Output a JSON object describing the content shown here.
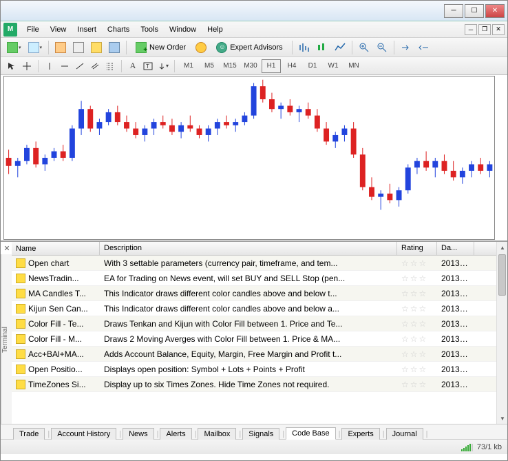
{
  "menu": {
    "items": [
      "File",
      "View",
      "Insert",
      "Charts",
      "Tools",
      "Window",
      "Help"
    ]
  },
  "toolbar": {
    "new_order": "New Order",
    "expert_advisors": "Expert Advisors"
  },
  "timeframes": [
    "M1",
    "M5",
    "M15",
    "M30",
    "H1",
    "H4",
    "D1",
    "W1",
    "MN"
  ],
  "active_timeframe": "H1",
  "terminal": {
    "label": "Terminal",
    "headers": {
      "name": "Name",
      "description": "Description",
      "rating": "Rating",
      "date": "Da..."
    },
    "rows": [
      {
        "name": "Open chart",
        "desc": "With 3 settable parameters (currency pair, timeframe, and tem...",
        "date": "2013.1..."
      },
      {
        "name": "NewsTradin...",
        "desc": "EA for Trading on News event, will set BUY and SELL Stop (pen...",
        "date": "2013.0..."
      },
      {
        "name": "MA Candles T...",
        "desc": "This Indicator draws different color candles above and below t...",
        "date": "2013.0..."
      },
      {
        "name": "Kijun Sen Can...",
        "desc": "This Indicator draws different color candles above and below a...",
        "date": "2013.0..."
      },
      {
        "name": "Color Fill - Te...",
        "desc": "Draws Tenkan and Kijun with Color Fill between 1. Price and Te...",
        "date": "2013.0..."
      },
      {
        "name": "Color Fill - M...",
        "desc": "Draws 2 Moving Averges with Color Fill between 1. Price & MA...",
        "date": "2013.0..."
      },
      {
        "name": "Acc+BAl+MA...",
        "desc": "Adds Account Balance, Equity, Margin, Free Margin and Profit t...",
        "date": "2013.0..."
      },
      {
        "name": "Open Positio...",
        "desc": "Displays open position: Symbol + Lots + Points + Profit",
        "date": "2013.0..."
      },
      {
        "name": "TimeZones Si...",
        "desc": "Display up to six Times Zones. Hide Time Zones not required.",
        "date": "2013.0..."
      }
    ],
    "tabs": [
      "Trade",
      "Account History",
      "News",
      "Alerts",
      "Mailbox",
      "Signals",
      "Code Base",
      "Experts",
      "Journal"
    ],
    "active_tab": "Code Base"
  },
  "status": {
    "transfer": "73/1 kb"
  },
  "chart_data": {
    "type": "candlestick",
    "note": "approximate OHLC read from pixels (relative scale 0-100)",
    "candles": [
      {
        "o": 50,
        "h": 55,
        "l": 40,
        "c": 45,
        "color": "red"
      },
      {
        "o": 45,
        "h": 50,
        "l": 38,
        "c": 48,
        "color": "blue"
      },
      {
        "o": 48,
        "h": 58,
        "l": 46,
        "c": 56,
        "color": "blue"
      },
      {
        "o": 56,
        "h": 60,
        "l": 44,
        "c": 46,
        "color": "red"
      },
      {
        "o": 46,
        "h": 52,
        "l": 42,
        "c": 50,
        "color": "blue"
      },
      {
        "o": 50,
        "h": 56,
        "l": 48,
        "c": 54,
        "color": "blue"
      },
      {
        "o": 54,
        "h": 58,
        "l": 48,
        "c": 50,
        "color": "red"
      },
      {
        "o": 50,
        "h": 70,
        "l": 48,
        "c": 68,
        "color": "blue"
      },
      {
        "o": 68,
        "h": 85,
        "l": 64,
        "c": 80,
        "color": "blue"
      },
      {
        "o": 80,
        "h": 82,
        "l": 66,
        "c": 68,
        "color": "red"
      },
      {
        "o": 68,
        "h": 74,
        "l": 64,
        "c": 72,
        "color": "blue"
      },
      {
        "o": 72,
        "h": 80,
        "l": 70,
        "c": 78,
        "color": "blue"
      },
      {
        "o": 78,
        "h": 82,
        "l": 70,
        "c": 72,
        "color": "red"
      },
      {
        "o": 72,
        "h": 76,
        "l": 66,
        "c": 68,
        "color": "red"
      },
      {
        "o": 68,
        "h": 72,
        "l": 62,
        "c": 64,
        "color": "red"
      },
      {
        "o": 64,
        "h": 70,
        "l": 60,
        "c": 68,
        "color": "blue"
      },
      {
        "o": 68,
        "h": 74,
        "l": 64,
        "c": 72,
        "color": "blue"
      },
      {
        "o": 72,
        "h": 76,
        "l": 68,
        "c": 70,
        "color": "red"
      },
      {
        "o": 70,
        "h": 74,
        "l": 64,
        "c": 66,
        "color": "red"
      },
      {
        "o": 66,
        "h": 72,
        "l": 62,
        "c": 70,
        "color": "blue"
      },
      {
        "o": 70,
        "h": 76,
        "l": 66,
        "c": 68,
        "color": "red"
      },
      {
        "o": 68,
        "h": 70,
        "l": 62,
        "c": 64,
        "color": "red"
      },
      {
        "o": 64,
        "h": 70,
        "l": 60,
        "c": 68,
        "color": "blue"
      },
      {
        "o": 68,
        "h": 74,
        "l": 64,
        "c": 72,
        "color": "blue"
      },
      {
        "o": 72,
        "h": 76,
        "l": 68,
        "c": 70,
        "color": "red"
      },
      {
        "o": 70,
        "h": 74,
        "l": 66,
        "c": 72,
        "color": "blue"
      },
      {
        "o": 72,
        "h": 78,
        "l": 70,
        "c": 76,
        "color": "blue"
      },
      {
        "o": 76,
        "h": 96,
        "l": 74,
        "c": 94,
        "color": "blue"
      },
      {
        "o": 94,
        "h": 98,
        "l": 84,
        "c": 86,
        "color": "red"
      },
      {
        "o": 86,
        "h": 90,
        "l": 78,
        "c": 80,
        "color": "red"
      },
      {
        "o": 80,
        "h": 84,
        "l": 74,
        "c": 82,
        "color": "blue"
      },
      {
        "o": 82,
        "h": 86,
        "l": 76,
        "c": 78,
        "color": "red"
      },
      {
        "o": 78,
        "h": 82,
        "l": 72,
        "c": 80,
        "color": "blue"
      },
      {
        "o": 80,
        "h": 84,
        "l": 74,
        "c": 76,
        "color": "red"
      },
      {
        "o": 76,
        "h": 80,
        "l": 66,
        "c": 68,
        "color": "red"
      },
      {
        "o": 68,
        "h": 72,
        "l": 58,
        "c": 60,
        "color": "red"
      },
      {
        "o": 60,
        "h": 66,
        "l": 56,
        "c": 64,
        "color": "blue"
      },
      {
        "o": 64,
        "h": 70,
        "l": 60,
        "c": 68,
        "color": "blue"
      },
      {
        "o": 68,
        "h": 72,
        "l": 50,
        "c": 52,
        "color": "red"
      },
      {
        "o": 52,
        "h": 56,
        "l": 30,
        "c": 32,
        "color": "red"
      },
      {
        "o": 32,
        "h": 38,
        "l": 24,
        "c": 26,
        "color": "red"
      },
      {
        "o": 26,
        "h": 30,
        "l": 18,
        "c": 28,
        "color": "blue"
      },
      {
        "o": 28,
        "h": 34,
        "l": 22,
        "c": 24,
        "color": "red"
      },
      {
        "o": 24,
        "h": 32,
        "l": 20,
        "c": 30,
        "color": "blue"
      },
      {
        "o": 30,
        "h": 46,
        "l": 28,
        "c": 44,
        "color": "blue"
      },
      {
        "o": 44,
        "h": 50,
        "l": 40,
        "c": 48,
        "color": "blue"
      },
      {
        "o": 48,
        "h": 54,
        "l": 42,
        "c": 44,
        "color": "red"
      },
      {
        "o": 44,
        "h": 50,
        "l": 38,
        "c": 48,
        "color": "blue"
      },
      {
        "o": 48,
        "h": 52,
        "l": 40,
        "c": 42,
        "color": "red"
      },
      {
        "o": 42,
        "h": 48,
        "l": 36,
        "c": 38,
        "color": "red"
      },
      {
        "o": 38,
        "h": 44,
        "l": 34,
        "c": 42,
        "color": "blue"
      },
      {
        "o": 42,
        "h": 48,
        "l": 38,
        "c": 46,
        "color": "blue"
      },
      {
        "o": 46,
        "h": 50,
        "l": 40,
        "c": 42,
        "color": "red"
      },
      {
        "o": 42,
        "h": 48,
        "l": 38,
        "c": 46,
        "color": "blue"
      }
    ]
  }
}
